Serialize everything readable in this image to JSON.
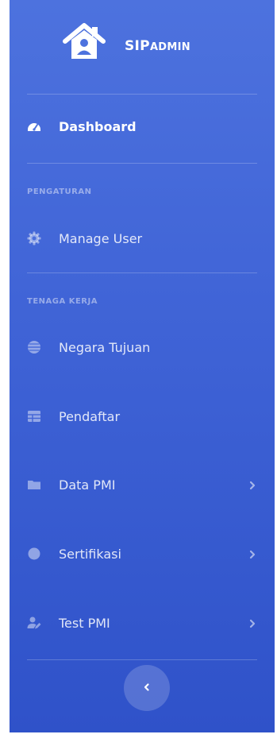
{
  "brand": {
    "title": "SIP",
    "subtitle": "ADMIN",
    "icon": "home-icon"
  },
  "nav": {
    "dashboard": {
      "label": "Dashboard",
      "icon": "tachometer-icon"
    },
    "sections": [
      {
        "label": "PENGATURAN"
      },
      {
        "label": "TENAGA KERJA"
      }
    ],
    "items": [
      {
        "label": "Manage User",
        "icon": "gear-icon"
      },
      {
        "label": "Negara Tujuan",
        "icon": "globe-icon"
      },
      {
        "label": "Pendaftar",
        "icon": "table-icon"
      },
      {
        "label": "Data PMI",
        "icon": "folder-icon"
      },
      {
        "label": "Sertifikasi",
        "icon": "circle-icon"
      },
      {
        "label": "Test PMI",
        "icon": "user-edit-icon"
      }
    ]
  },
  "colors": {
    "sidebar_top": "#4d72de",
    "sidebar_bottom": "#2f52c9",
    "text": "#ffffff"
  },
  "toggle": {
    "icon": "chevron-left-icon"
  }
}
